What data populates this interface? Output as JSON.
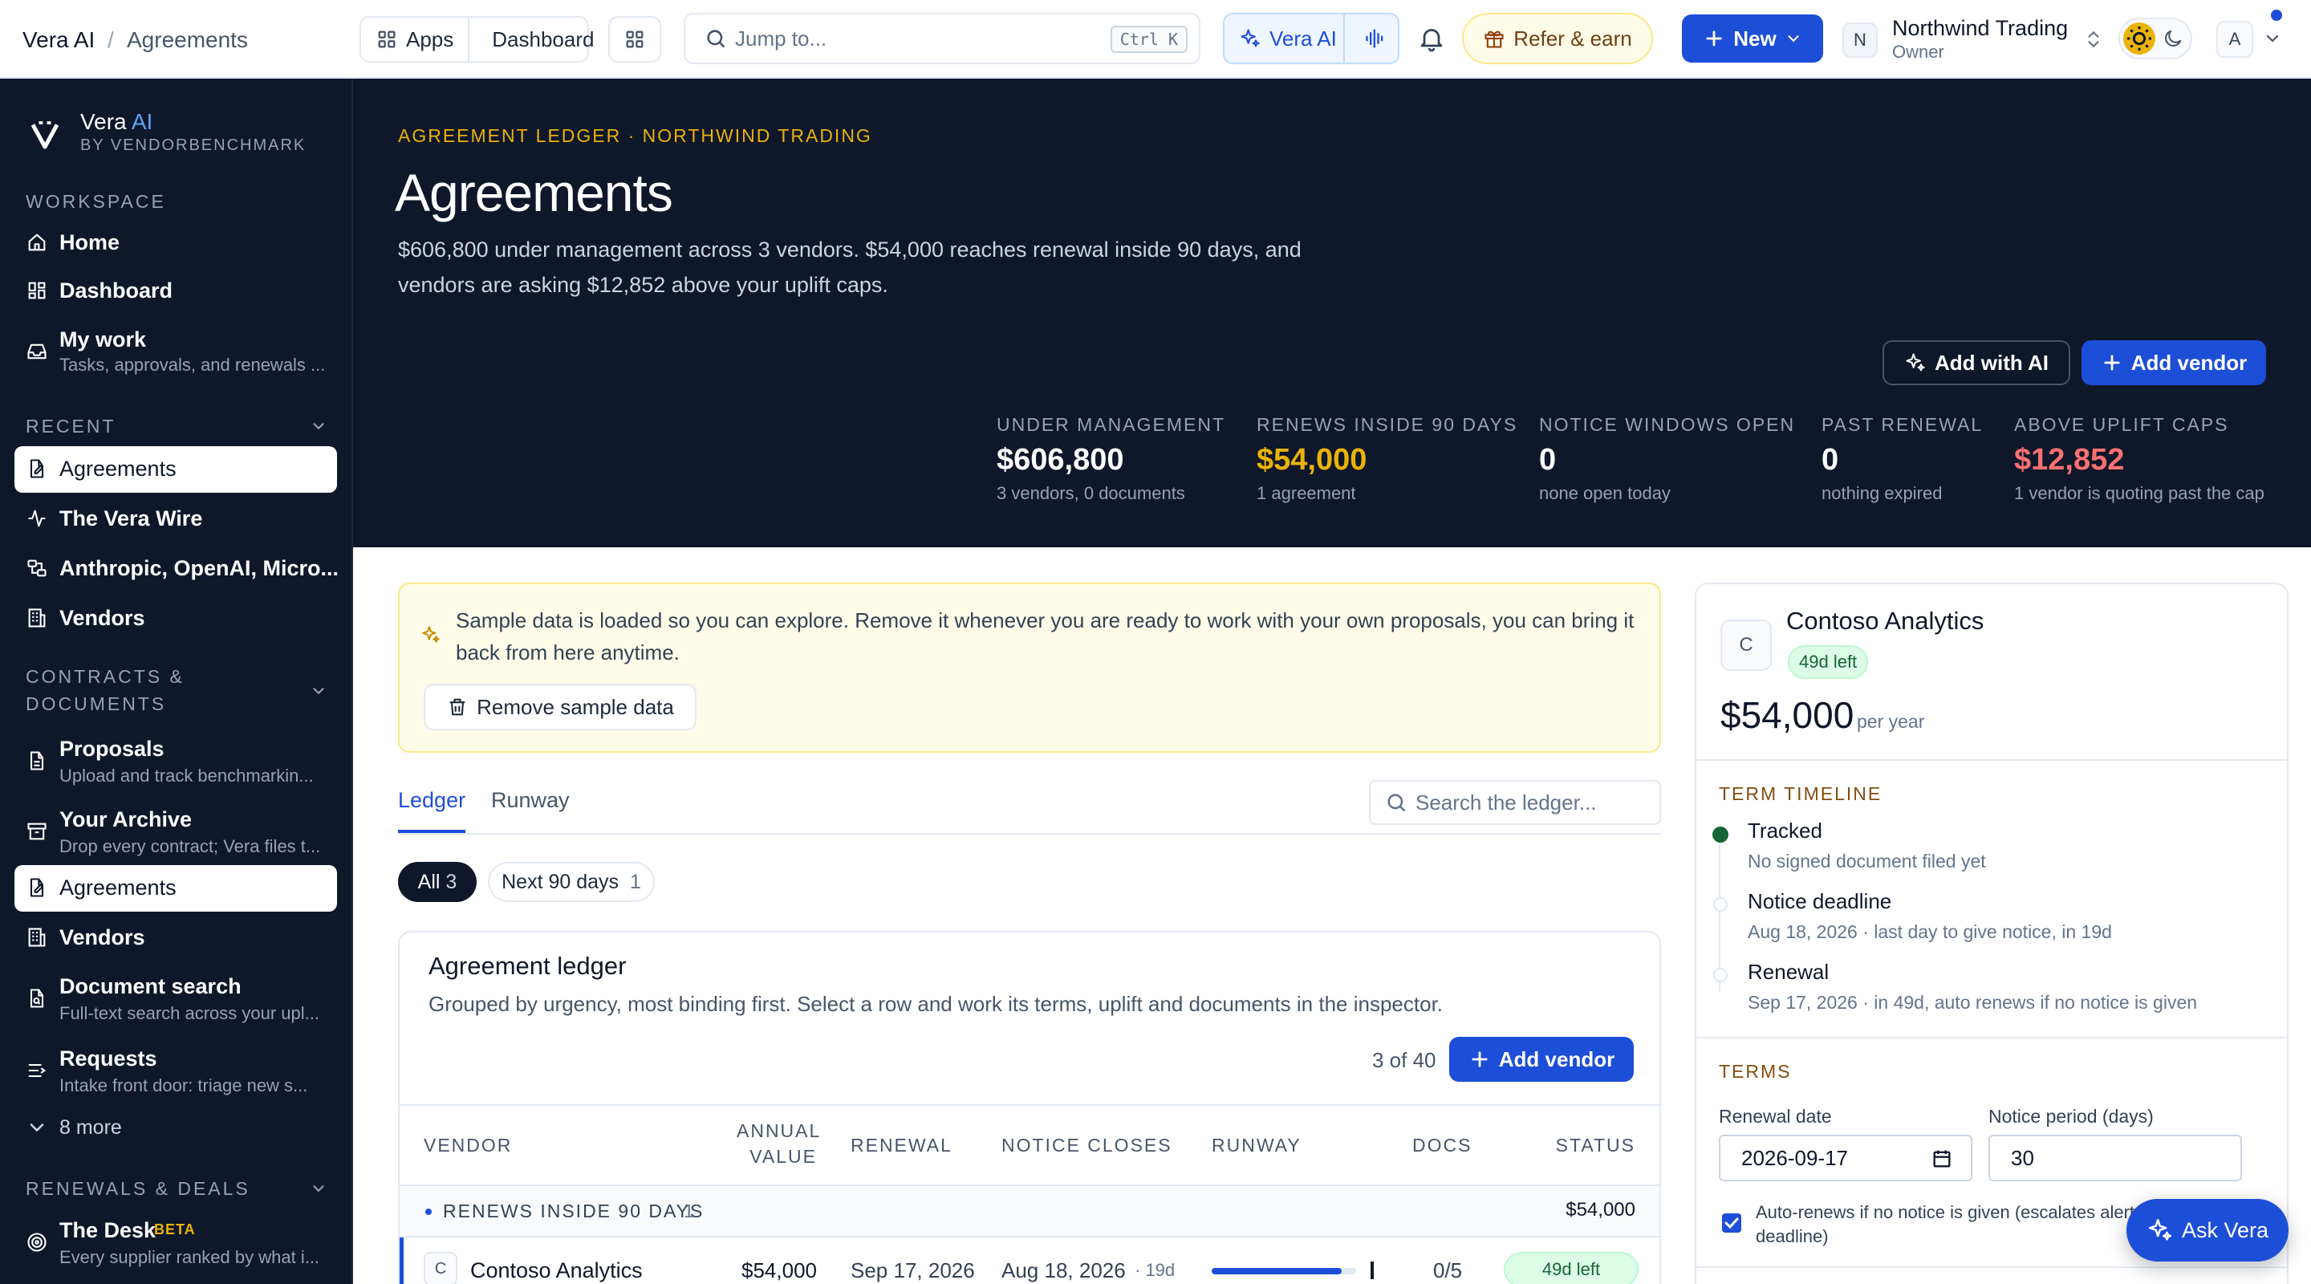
{
  "breadcrumb": {
    "root": "Vera AI",
    "separator": "/",
    "current": "Agreements"
  },
  "topbar": {
    "apps_label": "Apps",
    "dashboard_label": "Dashboard",
    "search_placeholder": "Jump to...",
    "search_shortcut": "Ctrl K",
    "vera_label": "Vera AI",
    "refer_label": "Refer & earn",
    "new_label": "New",
    "org_initial": "N",
    "org_name": "Northwind Trading",
    "org_role": "Owner",
    "user_initial": "A"
  },
  "brand": {
    "name": "Vera",
    "name_accent": "AI",
    "by": "BY VENDORBENCHMARK"
  },
  "sidebar": {
    "sections": {
      "workspace": "WORKSPACE",
      "recent": "RECENT",
      "contracts": [
        "CONTRACTS &",
        "DOCUMENTS"
      ],
      "renewals": "RENEWALS & DEALS"
    },
    "items": {
      "home": "Home",
      "dashboard": "Dashboard",
      "my_work": "My work",
      "my_work_sub": "Tasks, approvals, and renewals ...",
      "recent_agreements": "Agreements",
      "vera_wire": "The Vera Wire",
      "anthropic": "Anthropic, OpenAI, Micro...",
      "recent_vendors": "Vendors",
      "proposals": "Proposals",
      "proposals_sub": "Upload and track benchmarkin...",
      "archive": "Your Archive",
      "archive_sub": "Drop every contract; Vera files t...",
      "agreements": "Agreements",
      "vendors": "Vendors",
      "doc_search": "Document search",
      "doc_search_sub": "Full-text search across your upl...",
      "requests": "Requests",
      "requests_sub": "Intake front door: triage new s...",
      "more": "8 more",
      "desk": "The Desk",
      "desk_badge": "BETA",
      "desk_sub": "Every supplier ranked by what i..."
    }
  },
  "hero": {
    "eyebrow": "AGREEMENT LEDGER · NORTHWIND TRADING",
    "title": "Agreements",
    "summary_line1": "$606,800 under management across 3 vendors. $54,000 reaches renewal inside 90 days, and",
    "summary_line2": "vendors are asking $12,852 above your uplift caps.",
    "add_ai_label": "Add with AI",
    "add_vendor_label": "Add vendor",
    "kpis": [
      {
        "label": "UNDER MANAGEMENT",
        "value": "$606,800",
        "sub": "3 vendors, 0 documents",
        "color": "#ffffff"
      },
      {
        "label": "RENEWS INSIDE 90 DAYS",
        "value": "$54,000",
        "sub": "1 agreement",
        "color": "#eab308"
      },
      {
        "label": "NOTICE WINDOWS OPEN",
        "value": "0",
        "sub": "none open today",
        "color": "#ffffff"
      },
      {
        "label": "PAST RENEWAL",
        "value": "0",
        "sub": "nothing expired",
        "color": "#ffffff"
      },
      {
        "label": "ABOVE UPLIFT CAPS",
        "value": "$12,852",
        "sub": "1 vendor is quoting past the cap",
        "color": "#f87171"
      }
    ]
  },
  "notice": {
    "line1": "Sample data is loaded so you can explore. Remove it whenever you are ready to work with your own proposals, you can bring it",
    "line2": "back from here anytime.",
    "remove_label": "Remove sample data"
  },
  "tabs": {
    "ledger": "Ledger",
    "runway": "Runway",
    "search_placeholder": "Search the ledger..."
  },
  "filters": {
    "all_label": "All",
    "all_count": "3",
    "next90_label": "Next 90 days",
    "next90_count": "1"
  },
  "ledger": {
    "title": "Agreement ledger",
    "subtitle": "Grouped by urgency, most binding first. Select a row and work its terms, uplift and documents in the inspector.",
    "count": "3 of 40",
    "add_vendor_label": "Add vendor",
    "columns": {
      "vendor": "VENDOR",
      "annual_1": "ANNUAL",
      "annual_2": "VALUE",
      "renewal": "RENEWAL",
      "notice": "NOTICE CLOSES",
      "runway": "RUNWAY",
      "docs": "DOCS",
      "status": "STATUS"
    },
    "group": {
      "label": "RENEWS INSIDE 90 DAYS",
      "count": "1",
      "total": "$54,000"
    },
    "rows": [
      {
        "initial": "C",
        "vendor": "Contoso Analytics",
        "annual": "$54,000",
        "renewal": "Sep 17, 2026",
        "notice": "Aug 18, 2026",
        "notice_days": "· 19d",
        "runway_fraction": 0.9,
        "docs": "0/5",
        "status": "49d left"
      }
    ]
  },
  "inspector": {
    "initial": "C",
    "vendor": "Contoso Analytics",
    "badge": "49d left",
    "amount": "$54,000",
    "period": "per year",
    "timeline_title": "TERM TIMELINE",
    "timeline": [
      {
        "title": "Tracked",
        "sub": "No signed document filed yet"
      },
      {
        "title": "Notice deadline",
        "sub": "Aug 18, 2026 · last day to give notice, in 19d"
      },
      {
        "title": "Renewal",
        "sub": "Sep 17, 2026 · in 49d, auto renews if no notice is given"
      }
    ],
    "terms_title": "TERMS",
    "renewal_date_label": "Renewal date",
    "renewal_date_value": "2026-09-17",
    "notice_period_label": "Notice period (days)",
    "notice_period_value": "30",
    "auto_renew_line1": "Auto-renews if no notice is given (escalates alerts",
    "auto_renew_line2": "deadline)"
  },
  "ask_vera": "Ask Vera",
  "colors": {
    "navy": "#0f172a",
    "accent_blue": "#1d4ed8",
    "gold": "#eab308",
    "red": "#f87171",
    "success": "#16a34a"
  }
}
